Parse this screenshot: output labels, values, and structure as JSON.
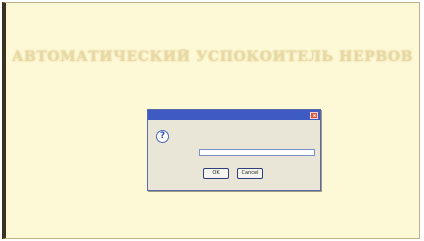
{
  "screen": {
    "headline": "АВТОМАТИЧЕСКИЙ УСПОКОИТЕЛЬ НЕРВОВ",
    "subtitle": ""
  },
  "dialog": {
    "title": "",
    "prompt": "",
    "field_label": "",
    "field_value": "",
    "ok_label": "OK",
    "cancel_label": "Cancel"
  },
  "colors": {
    "background": "#fdf8d6",
    "headline": "#e8d9a4",
    "titlebar": "#3d5bc2",
    "dialog_body": "#e9e6d8"
  },
  "icons": {
    "dialog": "question-icon",
    "titlebar_close": "close-icon"
  }
}
